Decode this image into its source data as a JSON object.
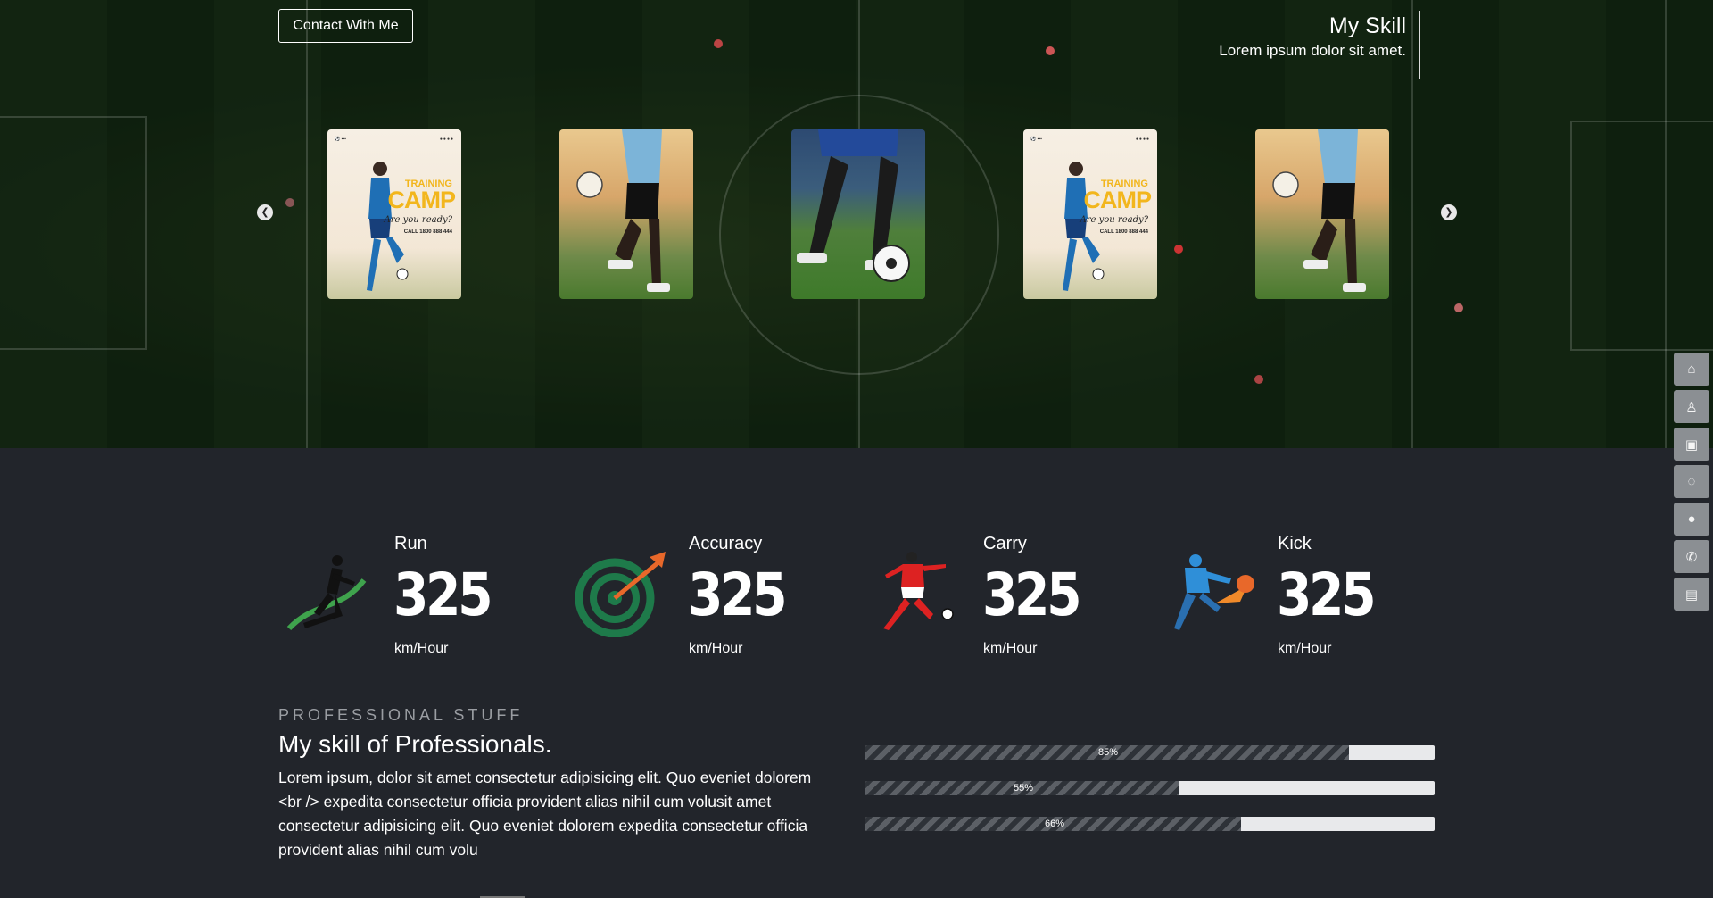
{
  "hero": {
    "contact_label": "Contact  With Me",
    "skill_title": "My Skill",
    "skill_subtitle": "Lorem ipsum dolor sit amet.",
    "prev_icon": "chevron-left-icon",
    "next_icon": "chevron-right-icon",
    "poster": {
      "training": "TRAINING",
      "camp": "CAMP",
      "ready": "Are you ready?",
      "call": "CALL 1800 888 444"
    }
  },
  "side_nav": {
    "items": [
      {
        "icon": "home-icon",
        "glyph": "⌂"
      },
      {
        "icon": "user-icon",
        "glyph": "♙"
      },
      {
        "icon": "gallery-icon",
        "glyph": "▣"
      },
      {
        "icon": "loading-icon",
        "glyph": "◌"
      },
      {
        "icon": "chat-icon",
        "glyph": "●"
      },
      {
        "icon": "phone-icon",
        "glyph": "✆"
      },
      {
        "icon": "clipboard-icon",
        "glyph": "▤"
      }
    ]
  },
  "stats": [
    {
      "label": "Run",
      "value": "325",
      "unit": "km/Hour",
      "icon": "runner-icon"
    },
    {
      "label": "Accuracy",
      "value": "325",
      "unit": "km/Hour",
      "icon": "target-icon"
    },
    {
      "label": "Carry",
      "value": "325",
      "unit": "km/Hour",
      "icon": "soccer-player-icon"
    },
    {
      "label": "Kick",
      "value": "325",
      "unit": "km/Hour",
      "icon": "kick-icon"
    }
  ],
  "professional": {
    "eyebrow": "PROFESSIONAL STUFF",
    "heading": "My skill of Professionals.",
    "body": "Lorem ipsum, dolor sit amet consectetur adipisicing elit. Quo eveniet dolorem <br /> expedita consectetur officia provident alias nihil cum volusit amet consectetur adipisicing elit. Quo eveniet dolorem expedita consectetur officia provident alias nihil cum volu",
    "bars": [
      {
        "label": "85%",
        "value": 0.85
      },
      {
        "label": "55%",
        "value": 0.55
      },
      {
        "label": "66%",
        "value": 0.66
      }
    ]
  },
  "colors": {
    "page_bg": "#22252b",
    "pitch_green": "#1d3a1c",
    "poster_yellow": "#f2b61d",
    "bar_track": "#e8e9eb",
    "side_button": "#8b8f93",
    "target_green": "#1e7a4a",
    "dart_orange": "#e8682a",
    "kick_blue": "#2f8fd8"
  }
}
